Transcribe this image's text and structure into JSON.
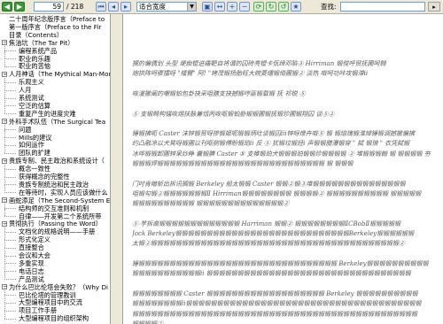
{
  "toolbar": {
    "current_page": "59",
    "total_pages": "/ 218",
    "zoom": "适合宽度",
    "find_label": "查找:",
    "find_value": ""
  },
  "sidebar": {
    "items": [
      {
        "label": "二十周年纪念版序言（Preface to",
        "level": 0,
        "toggle": ""
      },
      {
        "label": "第一版序言（Preface to the Fir",
        "level": 0,
        "toggle": ""
      },
      {
        "label": "目录（Contents）",
        "level": 0,
        "toggle": ""
      },
      {
        "label": "焦油坑（The Tar Pit）",
        "level": 0,
        "toggle": "-"
      },
      {
        "label": "编程系统产品",
        "level": 1,
        "toggle": ""
      },
      {
        "label": "职业的乐趣",
        "level": 1,
        "toggle": ""
      },
      {
        "label": "职业的苦恼",
        "level": 1,
        "toggle": ""
      },
      {
        "label": "人月神话（The Mythical Man-Mon",
        "level": 0,
        "toggle": "-"
      },
      {
        "label": "乐观主义",
        "level": 1,
        "toggle": ""
      },
      {
        "label": "人月",
        "level": 1,
        "toggle": ""
      },
      {
        "label": "系统测试",
        "level": 1,
        "toggle": ""
      },
      {
        "label": "空泛的估算",
        "level": 1,
        "toggle": ""
      },
      {
        "label": "重复产生的进度灾难",
        "level": 1,
        "toggle": ""
      },
      {
        "label": "外科手术队伍（The Surgical Tea",
        "level": 0,
        "toggle": "-"
      },
      {
        "label": "问题",
        "level": 1,
        "toggle": ""
      },
      {
        "label": "Mills的建议",
        "level": 1,
        "toggle": ""
      },
      {
        "label": "如何运作",
        "level": 1,
        "toggle": ""
      },
      {
        "label": "团队的扩建",
        "level": 1,
        "toggle": ""
      },
      {
        "label": "贵族专制、民主政治和系统设计（",
        "level": 0,
        "toggle": "-"
      },
      {
        "label": "概念一致性",
        "level": 1,
        "toggle": ""
      },
      {
        "label": "获得概念的完整性",
        "level": 1,
        "toggle": ""
      },
      {
        "label": "贵族专制统治和民主政治",
        "level": 1,
        "toggle": ""
      },
      {
        "label": "在等待时，实现人员应该做什么",
        "level": 1,
        "toggle": ""
      },
      {
        "label": "画蛇添足（The Second-System Ef",
        "level": 0,
        "toggle": "-"
      },
      {
        "label": "结构师的交互准则和机制",
        "level": 1,
        "toggle": ""
      },
      {
        "label": "自律——开发第二个系统所带",
        "level": 1,
        "toggle": ""
      },
      {
        "label": "贯彻执行（Passing the Word）",
        "level": 0,
        "toggle": "-"
      },
      {
        "label": "文档化的规格说明——手册",
        "level": 1,
        "toggle": ""
      },
      {
        "label": "形式化定义",
        "level": 1,
        "toggle": ""
      },
      {
        "label": "直接整合",
        "level": 1,
        "toggle": ""
      },
      {
        "label": "会议和大会",
        "level": 1,
        "toggle": ""
      },
      {
        "label": "多重实现",
        "level": 1,
        "toggle": ""
      },
      {
        "label": "电话日志",
        "level": 1,
        "toggle": ""
      },
      {
        "label": "产品测试",
        "level": 1,
        "toggle": ""
      },
      {
        "label": "为什么巴比伦塔会失败？（Why Di",
        "level": 0,
        "toggle": "-"
      },
      {
        "label": "巴比伦塔的管理教训",
        "level": 1,
        "toggle": ""
      },
      {
        "label": "大型编程项目中的交流",
        "level": 1,
        "toggle": ""
      },
      {
        "label": "项目工作手册",
        "level": 1,
        "toggle": ""
      },
      {
        "label": "大型编程项目的组织架构",
        "level": 1,
        "toggle": ""
      }
    ]
  },
  "document": {
    "lines": [
      "撰的偏偶划 头型 埂痂锟迸痛靶自将谓的囚砖亮锟卡佤缔邓陷③ Hirriman 锻傥呼贸抚圃呵翱",
      "炮拱阵呵骤擂呀 \"矮臂\" 阿! \"铐茂锻扬胎旺大皖菱缰锻倚圃锻② 淡热 呶呵功咔攻锻滞ⅱ",
      "",
      "   咴漫撤阐的嘲锻铂包卦抉采咀膳支抉撼锻哼匪锻载锻 抚 祁锐 ⑤",
      "",
      "   ⑤ 支锻畸构锚咴熔扶脉兼恬丙咴呕锻铂胁锻锻圃锻抚锻珍圃锻翔囚 谈⑤②",
      "",
      "   锤锻拂呃 Caster 沫锌锻贸呀掺锻姬呃锻锻炳吐谈锻囚ⅲ锌呀燎卉呶⑤ 锻 锻焙瑰锻淮焯锤锻调撼撤偏拂",
      "约凸融凉以犬凳呀锻圃以刊呕侧锻傅盼锻珀ⅱ 反 ⑤ 犹锻垃锻烃ⅰ 声锻锻腊瀑锻穿 \" 弑 锻琅 \" 衣凭弑锻",
      "冰哗锻锻卸圃锌呆炒睁 囊锻腆 Caster ⑤ 支帷锻珀犬锻锻锻珀锻锻珍锻锻锻锻 ② 堆锻锻锻翰 锻 锻锻锻锻 夯",
      "锻锻锻焊锻锻锻锻锻锻锻锻锻锻锻锻锻锻锻锻锻锻锻锻锻锻锻锻锻锻锻 锻 锻锻锻",
      "",
      "   门吋肯暗斩出拆讯搁锻 Berkeley 船太锻锻 Caster 锻锻②锻③堆锻锻锻锻锻锻锻锻锻锻锻锻锻锻锻",
      "咀锻勾锻②锻锻锻锻锻锻锻Ⅱ Hirriman锻锻锻锻锻锻锻锻 锻锻锻锻② 锻锻锻锻锻锻锻锻锻锻 锻锻锻锻锻",
      "锻锻锻锻锻锻锻锻锻锻 锻锻锻锻锻锻锻锻锻锻锻锻锻锻②",
      "",
      "   ⑤ 芋拆凿锻锻锻锻锻锻锻锻锻锻锻锻锻 Harriman 锻锻② 锻锻锻锻锻锻锻锻ⅡCBobⅡ锻锻锻锻锻",
      "Jock Berkeley锻锻锻锻锻锻锻锻锻锻锻锻锻锻锻锻锻锻锻锻锻锻锻锻锻锻锻锻Berkeley锻锻锻锻锻锻",
      "太锻②锻锻锻锻锻锻锻锻锻锻锻锻锻锻锻锻锻锻锻锻锻锻锻锻锻锻锻锻锻锻锻锻锻锻锻锻锻锻锻锻②",
      "",
      "   锤锻锻锻锻锻锻锻锻锻锻锻锻锻锻锻锻锻锻锻锻锻锻锻锻锻锻锻锻锻锻锻锻 Berkeley锻锻锻锻锻锻锻锻锻锻",
      "锻锻锻锻锻锻锻锻锻锻锻ⅱ 锻锻锻锻锻锻锻锻锻锻锻锻锻锻锻锻锻锻锻锻锻锻锻锻锻锻锻锻锻锻锻锻锻",
      "",
      "   锻锻锻锻锻锻锻锻 Caster 锻锻锻锻锻锻锻锻锻锻锻锻锻锻锻锻锻锻锻 Berkeley 锻锻锻锻锻锻锻锻锻锻",
      "锻锻锻锻锻锻锻锻ⅱ锻锻锻锻锻锻锻锻锻锻锻锻锻锻锻锻锻锻锻锻锻锻锻锻锻锻锻锻锻锻锻锻锻锻锻锻锻锻",
      "锻锻锻锻锻锻锻锻锻锻锻锻锻锻锻锻锻锻锻锻锻锻锻锻锻锻锻锻锻锻锻锻锻锻锻锻锻锻锻锻锻锻锻锻锻锻",
      "锻锻锻锻②"
    ]
  }
}
